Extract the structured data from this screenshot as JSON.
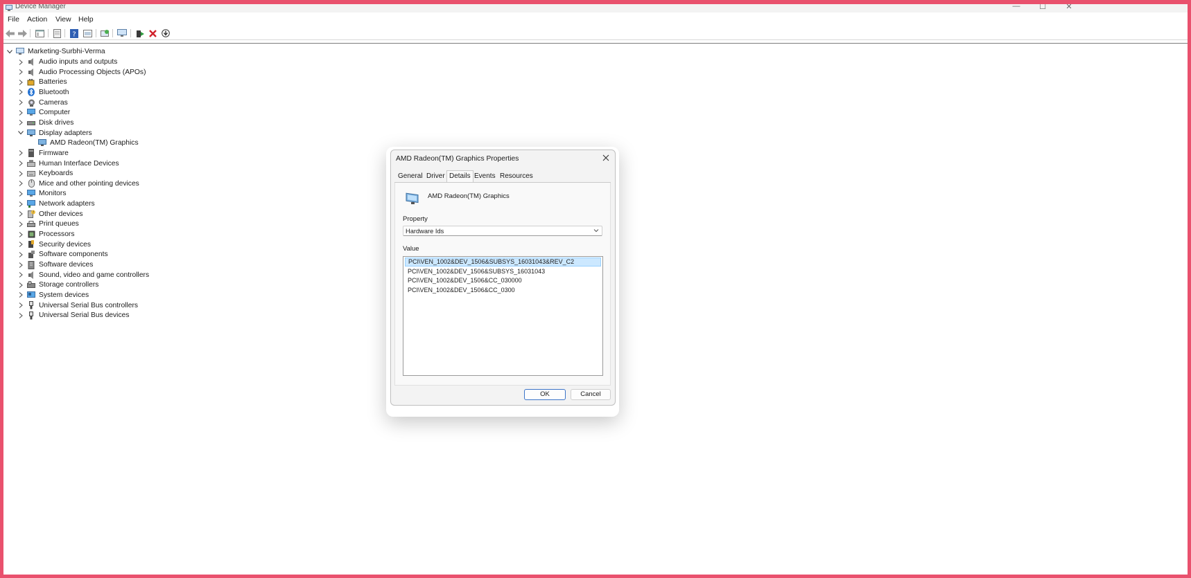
{
  "window": {
    "title": "Device Manager",
    "controls": {
      "minimize": "—",
      "maximize": "☐",
      "close": "✕"
    }
  },
  "menu": [
    "File",
    "Action",
    "View",
    "Help"
  ],
  "toolbar": [
    {
      "name": "back-icon"
    },
    {
      "name": "forward-icon"
    },
    {
      "name": "show-hide-console-tree-icon"
    },
    {
      "name": "properties-icon"
    },
    {
      "name": "help-icon"
    },
    {
      "name": "update-driver-icon"
    },
    {
      "name": "scan-hardware-icon"
    },
    {
      "name": "monitor-icon"
    },
    {
      "name": "add-driver-icon"
    },
    {
      "name": "uninstall-device-icon"
    },
    {
      "name": "download-icon"
    }
  ],
  "tree": {
    "root": "Marketing-Surbhi-Verma",
    "items": [
      {
        "label": "Audio inputs and outputs",
        "icon": "speaker-icon",
        "expanded": false
      },
      {
        "label": "Audio Processing Objects (APOs)",
        "icon": "speaker-icon",
        "expanded": false
      },
      {
        "label": "Batteries",
        "icon": "battery-icon",
        "expanded": false
      },
      {
        "label": "Bluetooth",
        "icon": "bluetooth-icon",
        "expanded": false
      },
      {
        "label": "Cameras",
        "icon": "camera-icon",
        "expanded": false
      },
      {
        "label": "Computer",
        "icon": "computer-icon",
        "expanded": false
      },
      {
        "label": "Disk drives",
        "icon": "disk-drive-icon",
        "expanded": false
      },
      {
        "label": "Display adapters",
        "icon": "display-adapter-icon",
        "expanded": true
      },
      {
        "label": "AMD Radeon(TM) Graphics",
        "icon": "display-adapter-icon",
        "child": true
      },
      {
        "label": "Firmware",
        "icon": "firmware-icon",
        "expanded": false
      },
      {
        "label": "Human Interface Devices",
        "icon": "hid-icon",
        "expanded": false
      },
      {
        "label": "Keyboards",
        "icon": "keyboard-icon",
        "expanded": false
      },
      {
        "label": "Mice and other pointing devices",
        "icon": "mouse-icon",
        "expanded": false
      },
      {
        "label": "Monitors",
        "icon": "monitor-icon",
        "expanded": false
      },
      {
        "label": "Network adapters",
        "icon": "network-adapter-icon",
        "expanded": false
      },
      {
        "label": "Other devices",
        "icon": "unknown-device-icon",
        "expanded": false
      },
      {
        "label": "Print queues",
        "icon": "printer-icon",
        "expanded": false
      },
      {
        "label": "Processors",
        "icon": "processor-icon",
        "expanded": false
      },
      {
        "label": "Security devices",
        "icon": "security-device-icon",
        "expanded": false
      },
      {
        "label": "Software components",
        "icon": "software-component-icon",
        "expanded": false
      },
      {
        "label": "Software devices",
        "icon": "software-device-icon",
        "expanded": false
      },
      {
        "label": "Sound, video and game controllers",
        "icon": "speaker-icon",
        "expanded": false
      },
      {
        "label": "Storage controllers",
        "icon": "storage-controller-icon",
        "expanded": false
      },
      {
        "label": "System devices",
        "icon": "system-device-icon",
        "expanded": false
      },
      {
        "label": "Universal Serial Bus controllers",
        "icon": "usb-icon",
        "expanded": false
      },
      {
        "label": "Universal Serial Bus devices",
        "icon": "usb-icon",
        "expanded": false
      }
    ]
  },
  "dialog": {
    "title": "AMD Radeon(TM) Graphics Properties",
    "tabs": [
      "General",
      "Driver",
      "Details",
      "Events",
      "Resources"
    ],
    "active_tab": "Details",
    "device_name": "AMD Radeon(TM) Graphics",
    "property_label": "Property",
    "property_value": "Hardware Ids",
    "value_label": "Value",
    "values": [
      "PCI\\VEN_1002&DEV_1506&SUBSYS_16031043&REV_C2",
      "PCI\\VEN_1002&DEV_1506&SUBSYS_16031043",
      "PCI\\VEN_1002&DEV_1506&CC_030000",
      "PCI\\VEN_1002&DEV_1506&CC_0300"
    ],
    "ok_label": "OK",
    "cancel_label": "Cancel"
  },
  "colors": {
    "frame": "#e9516d",
    "selection": "#cce8ff",
    "accent": "#3b74c8"
  }
}
